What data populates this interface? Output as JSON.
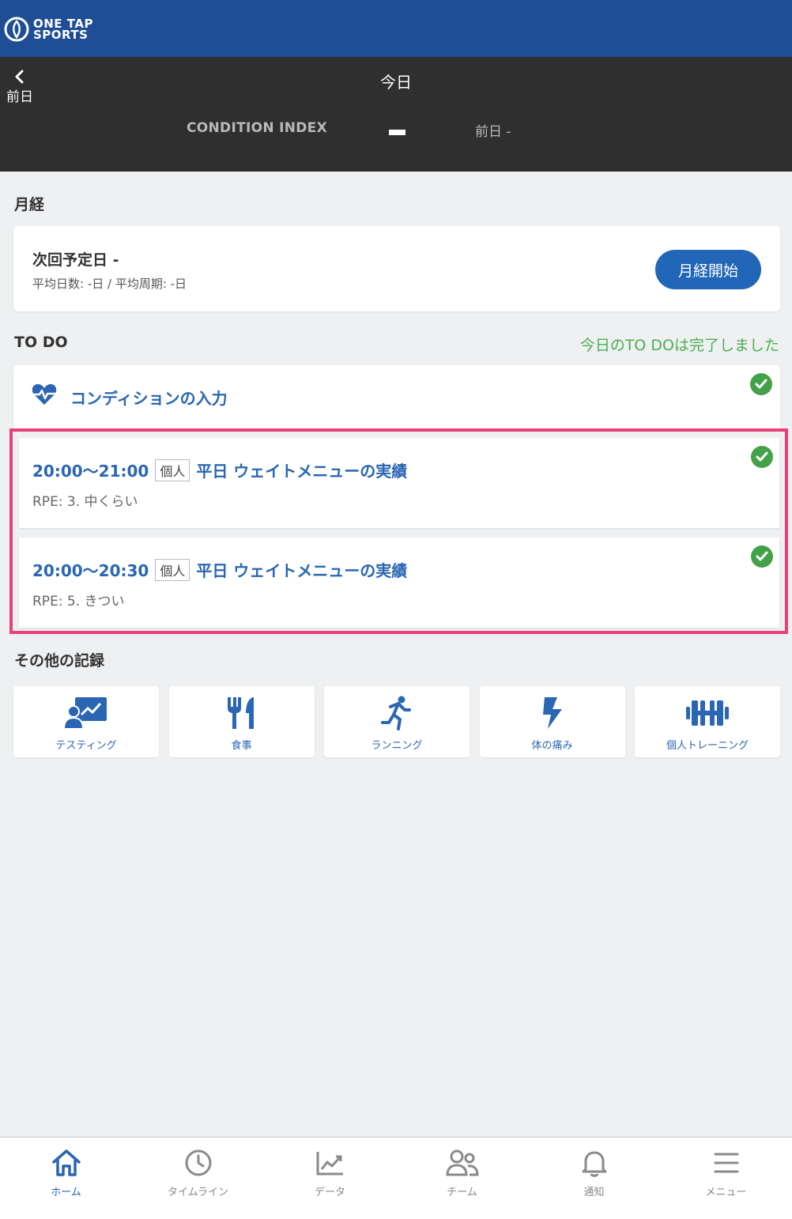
{
  "app": {
    "logo_line1": "ONE TAP",
    "logo_line2": "SPORTS"
  },
  "day_header": {
    "prev_label": "前日",
    "title": "今日",
    "condition_index_label": "CONDITION INDEX",
    "previous_day_value": "前日 -"
  },
  "menses": {
    "section_title": "月経",
    "next_date": "次回予定日 -",
    "stats": "平均日数: -日 / 平均周期: -日",
    "start_button": "月経開始"
  },
  "todo": {
    "section_title": "TO DO",
    "done_message": "今日のTO DOは完了しました",
    "condition_item": "コンディションの入力",
    "trainings": [
      {
        "time": "20:00〜21:00",
        "tag": "個人",
        "name": "平日 ウェイトメニューの実績",
        "rpe": "RPE: 3. 中くらい"
      },
      {
        "time": "20:00〜20:30",
        "tag": "個人",
        "name": "平日 ウェイトメニューの実績",
        "rpe": "RPE: 5. きつい"
      }
    ]
  },
  "other_records": {
    "section_title": "その他の記録",
    "items": [
      {
        "label": "テスティング",
        "icon": "testing-icon"
      },
      {
        "label": "食事",
        "icon": "meal-icon"
      },
      {
        "label": "ランニング",
        "icon": "running-icon"
      },
      {
        "label": "体の痛み",
        "icon": "pain-icon"
      },
      {
        "label": "個人トレーニング",
        "icon": "dumbbell-icon"
      }
    ]
  },
  "bottom_nav": {
    "items": [
      {
        "label": "ホーム",
        "icon": "home-icon",
        "active": true
      },
      {
        "label": "タイムライン",
        "icon": "clock-icon",
        "active": false
      },
      {
        "label": "データ",
        "icon": "chart-icon",
        "active": false
      },
      {
        "label": "チーム",
        "icon": "team-icon",
        "active": false
      },
      {
        "label": "通知",
        "icon": "bell-icon",
        "active": false
      },
      {
        "label": "メニュー",
        "icon": "menu-icon",
        "active": false
      }
    ]
  },
  "colors": {
    "brand_blue": "#1f4e96",
    "accent_blue": "#2a66b3",
    "success_green": "#43a14a",
    "highlight_pink": "#e8417a",
    "header_dark": "#2f2f2f"
  }
}
